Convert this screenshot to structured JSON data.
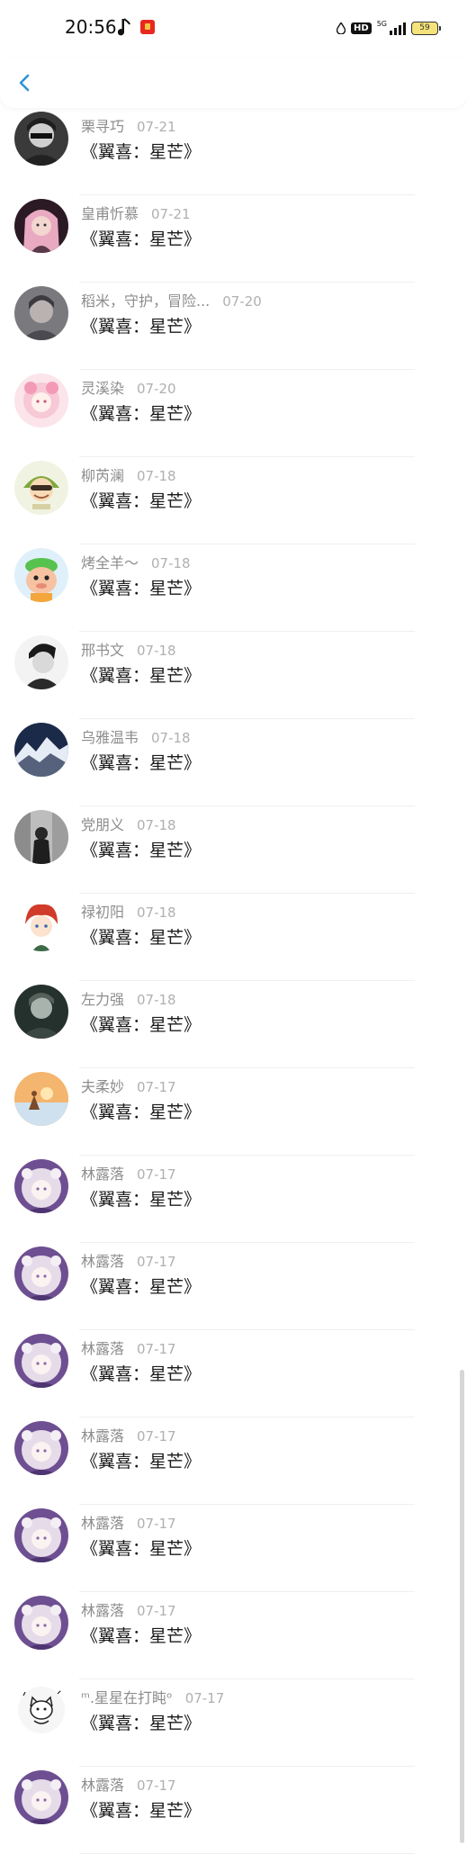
{
  "status": {
    "time": "20:56",
    "hd": "HD",
    "signal_label": "5G",
    "battery": "59"
  },
  "colors": {
    "accent": "#2e93d8"
  },
  "items": [
    {
      "name": "栗寻巧",
      "date": "07-21",
      "text": "《翼喜：星芒》",
      "avatar": "dark-portrait"
    },
    {
      "name": "皇甫忻慕",
      "date": "07-21",
      "text": "《翼喜：星芒》",
      "avatar": "pink-hair-girl"
    },
    {
      "name": "稻米，守护，冒险...",
      "date": "07-20",
      "text": "《翼喜：星芒》",
      "avatar": "grey-portrait"
    },
    {
      "name": "灵溪染",
      "date": "07-20",
      "text": "《翼喜：星芒》",
      "avatar": "pink-anime"
    },
    {
      "name": "柳芮澜",
      "date": "07-18",
      "text": "《翼喜：星芒》",
      "avatar": "cartoon-boy"
    },
    {
      "name": "烤全羊～",
      "date": "07-18",
      "text": "《翼喜：星芒》",
      "avatar": "cartoon-sheep"
    },
    {
      "name": "邢书文",
      "date": "07-18",
      "text": "《翼喜：星芒》",
      "avatar": "bw-portrait"
    },
    {
      "name": "乌雅温韦",
      "date": "07-18",
      "text": "《翼喜：星芒》",
      "avatar": "mountain-night"
    },
    {
      "name": "党朋义",
      "date": "07-18",
      "text": "《翼喜：星芒》",
      "avatar": "bw-street"
    },
    {
      "name": "禄初阳",
      "date": "07-18",
      "text": "《翼喜：星芒》",
      "avatar": "red-hair-chibi"
    },
    {
      "name": "左力强",
      "date": "07-18",
      "text": "《翼喜：星芒》",
      "avatar": "dark-green-portrait"
    },
    {
      "name": "夫柔妙",
      "date": "07-17",
      "text": "《翼喜：星芒》",
      "avatar": "sunset-scene"
    },
    {
      "name": "林露落",
      "date": "07-17",
      "text": "《翼喜：星芒》",
      "avatar": "purple-anime"
    },
    {
      "name": "林露落",
      "date": "07-17",
      "text": "《翼喜：星芒》",
      "avatar": "purple-anime"
    },
    {
      "name": "林露落",
      "date": "07-17",
      "text": "《翼喜：星芒》",
      "avatar": "purple-anime"
    },
    {
      "name": "林露落",
      "date": "07-17",
      "text": "《翼喜：星芒》",
      "avatar": "purple-anime"
    },
    {
      "name": "林露落",
      "date": "07-17",
      "text": "《翼喜：星芒》",
      "avatar": "purple-anime"
    },
    {
      "name": "林露落",
      "date": "07-17",
      "text": "《翼喜：星芒》",
      "avatar": "purple-anime"
    },
    {
      "name": "ᵐ.星星在打盹ᵒ",
      "date": "07-17",
      "text": "《翼喜：星芒》",
      "avatar": "sketch-cat"
    },
    {
      "name": "林露落",
      "date": "07-17",
      "text": "《翼喜：星芒》",
      "avatar": "purple-anime"
    }
  ]
}
